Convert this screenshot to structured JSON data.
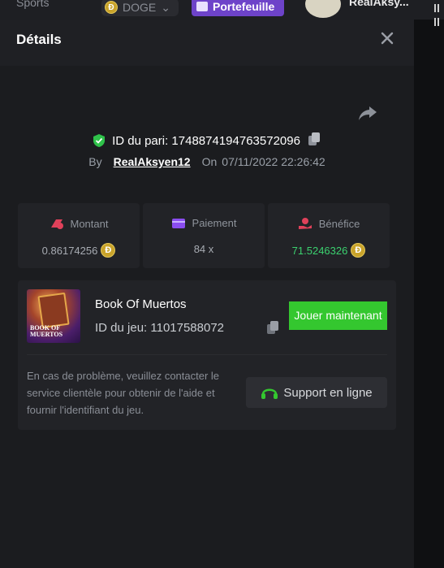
{
  "topbar": {
    "sports_label": "Sports",
    "currency_label": "DOGE",
    "currency_icon": "doge-coin-icon",
    "wallet_label": "Portefeuille",
    "username": "RealAksy..."
  },
  "modal": {
    "title": "Détails",
    "bet_id_label": "ID du pari: 1748874194763572096",
    "by_label": "By",
    "user": "RealAksyen12",
    "on_label": "On",
    "date": "07/11/2022 22:26:42"
  },
  "stats": [
    {
      "label": "Montant",
      "value": "0.86174256",
      "icon": "amount-icon",
      "coin": true
    },
    {
      "label": "Paiement",
      "value": "84 x",
      "icon": "payment-card-icon",
      "coin": false
    },
    {
      "label": "Bénéfice",
      "value": "71.5246326",
      "icon": "profit-hand-icon",
      "coin": true
    }
  ],
  "game": {
    "name": "Book Of Muertos",
    "thumb_text": "BOOK OF MUERTOS",
    "id_label": "ID du jeu: 11017588072",
    "play_label": "Jouer maintenant",
    "help_text": "En cas de problème, veuillez contacter le service clientèle pour obtenir de l'aide et fournir l'identifiant du jeu.",
    "support_label": "Support en ligne"
  },
  "colors": {
    "accent_purple": "#6d43c9",
    "green": "#34c72f",
    "profit_green": "#3bd16f",
    "coin_gold": "#c9a32a"
  }
}
